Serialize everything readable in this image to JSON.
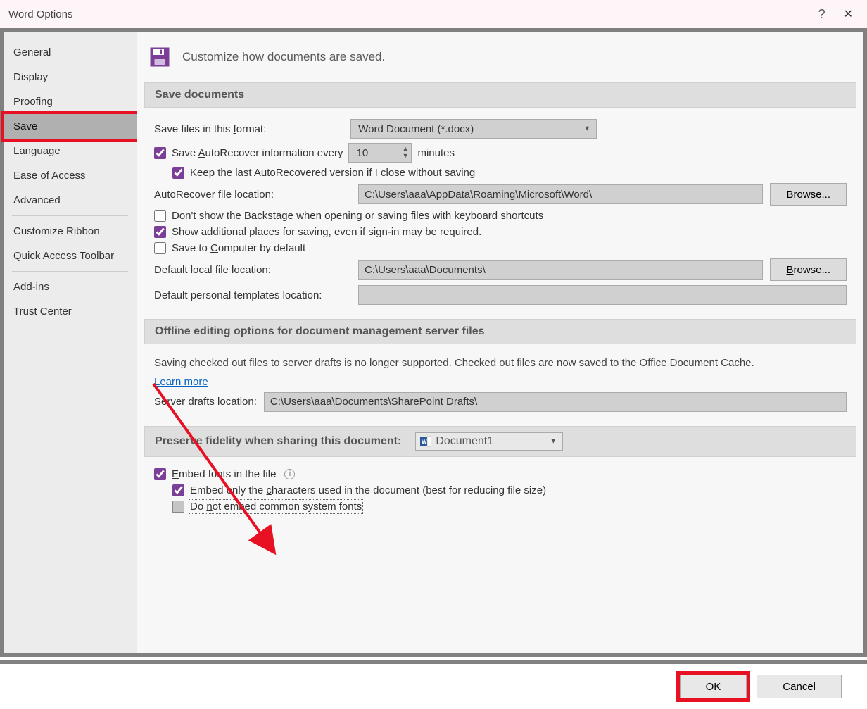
{
  "window": {
    "title": "Word Options",
    "help": "?",
    "close": "✕"
  },
  "sidebar": {
    "items": [
      {
        "label": "General",
        "id": "general"
      },
      {
        "label": "Display",
        "id": "display"
      },
      {
        "label": "Proofing",
        "id": "proofing"
      },
      {
        "label": "Save",
        "id": "save",
        "selected": true,
        "highlighted": true
      },
      {
        "label": "Language",
        "id": "language"
      },
      {
        "label": "Ease of Access",
        "id": "ease-of-access"
      },
      {
        "label": "Advanced",
        "id": "advanced"
      },
      {
        "label": "Customize Ribbon",
        "id": "customize-ribbon"
      },
      {
        "label": "Quick Access Toolbar",
        "id": "quick-access-toolbar"
      },
      {
        "label": "Add-ins",
        "id": "add-ins"
      },
      {
        "label": "Trust Center",
        "id": "trust-center"
      }
    ]
  },
  "header": {
    "text": "Customize how documents are saved."
  },
  "sections": {
    "save_documents": {
      "title": "Save documents",
      "format_label_pre": "Save files in this ",
      "format_label_u": "f",
      "format_label_post": "ormat:",
      "format_value": "Word Document (*.docx)",
      "autorecover_pre": "Save ",
      "autorecover_u": "A",
      "autorecover_post": "utoRecover information every",
      "autorecover_value": "10",
      "autorecover_unit": "minutes",
      "keep_last_pre": "Keep the last A",
      "keep_last_u": "u",
      "keep_last_post": "toRecovered version if I close without saving",
      "ar_loc_label_pre": "Auto",
      "ar_loc_label_u": "R",
      "ar_loc_label_post": "ecover file location:",
      "ar_loc_value": "C:\\Users\\aaa\\AppData\\Roaming\\Microsoft\\Word\\",
      "browse1": "Browse...",
      "dont_show_pre": "Don't ",
      "dont_show_u": "s",
      "dont_show_post": "how the Backstage when opening or saving files with keyboard shortcuts",
      "show_additional": "Show additional places for saving, even if sign-in may be required.",
      "save_computer_pre": "Save to ",
      "save_computer_u": "C",
      "save_computer_post": "omputer by default",
      "default_local_label": "Default local file location:",
      "default_local_value": "C:\\Users\\aaa\\Documents\\",
      "browse2": "Browse...",
      "templates_label": "Default personal templates location:",
      "templates_value": ""
    },
    "offline": {
      "title": "Offline editing options for document management server files",
      "desc": "Saving checked out files to server drafts is no longer supported. Checked out files are now saved to the Office Document Cache.",
      "learn_more": "Learn more",
      "drafts_label_pre": "Ser",
      "drafts_label_u": "v",
      "drafts_label_post": "er drafts location:",
      "drafts_value": "C:\\Users\\aaa\\Documents\\SharePoint Drafts\\"
    },
    "fidelity": {
      "title": "Preserve fidelity when sharing this document:",
      "doc_combo": "Document1",
      "embed_pre": "E",
      "embed_u": "m",
      "embed_post": "bed fonts in the file",
      "embed_only_pre": "Embed only the ",
      "embed_only_u": "c",
      "embed_only_post": "haracters used in the document (best for reducing file size)",
      "no_common_pre": "Do ",
      "no_common_u": "n",
      "no_common_post": "ot embed common system fonts"
    }
  },
  "footer": {
    "ok": "OK",
    "cancel": "Cancel"
  }
}
